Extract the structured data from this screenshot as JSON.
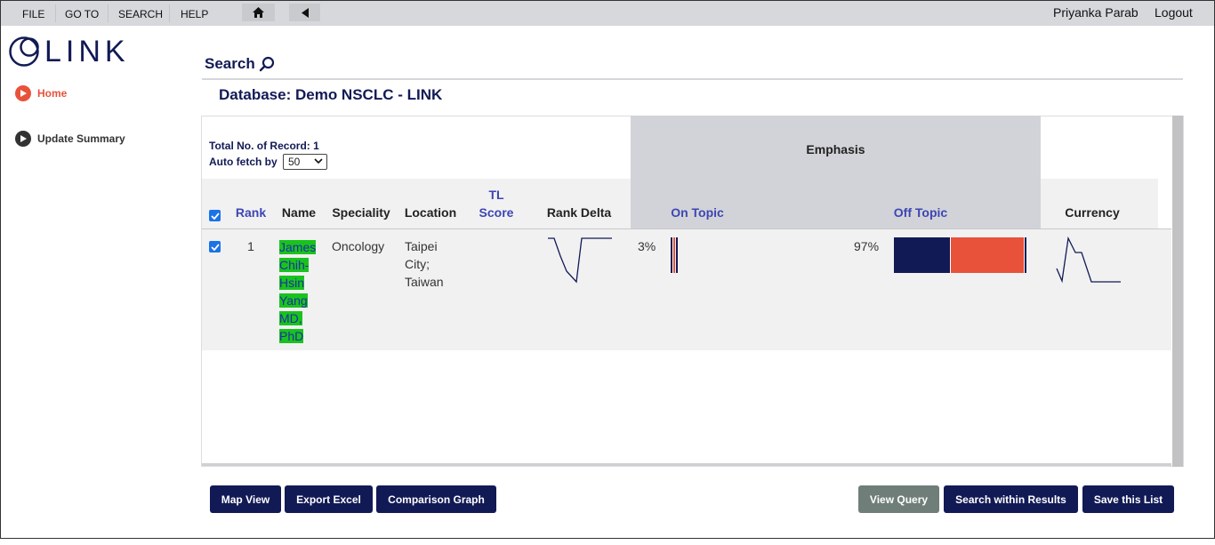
{
  "menu": {
    "items": [
      "FILE",
      "GO TO",
      "SEARCH",
      "HELP"
    ],
    "user_name": "Priyanka Parab",
    "logout": "Logout"
  },
  "logo": {
    "text": "LINK"
  },
  "sidebar": {
    "items": [
      {
        "label": "Home",
        "active": true
      },
      {
        "label": "Update Summary",
        "active": false
      }
    ]
  },
  "search": {
    "heading": "Search"
  },
  "database": {
    "title": "Database: Demo NSCLC - LINK"
  },
  "results": {
    "total_label": "Total No. of Record: 1",
    "fetch_label": "Auto fetch by",
    "fetch_value": "50",
    "emphasis_title": "Emphasis",
    "columns": {
      "rank": "Rank",
      "name": "Name",
      "speciality": "Speciality",
      "location": "Location",
      "tl_score_1": "TL",
      "tl_score_2": "Score",
      "rank_delta": "Rank Delta",
      "on_topic": "On Topic",
      "off_topic": "Off Topic",
      "currency": "Currency"
    },
    "rows": [
      {
        "rank": "1",
        "name_lines": [
          "James",
          "Chih-",
          "Hsin",
          "Yang",
          "MD,",
          "PhD"
        ],
        "speciality": "Oncology",
        "location_lines": [
          "Taipei",
          "City;",
          "Taiwan"
        ],
        "tl_score": "",
        "on_topic_pct": "3%",
        "off_topic_pct": "97%",
        "on_topic_value": 3,
        "off_topic_value": 97
      }
    ]
  },
  "buttons": {
    "map_view": "Map View",
    "export_excel": "Export Excel",
    "comparison_graph": "Comparison Graph",
    "view_query": "View Query",
    "search_within": "Search within Results",
    "save_list": "Save this List"
  },
  "colors": {
    "brand_navy": "#121a55",
    "accent_red": "#e8523a",
    "highlight_green": "#19c31d",
    "header_grey": "#d2d3d8"
  }
}
